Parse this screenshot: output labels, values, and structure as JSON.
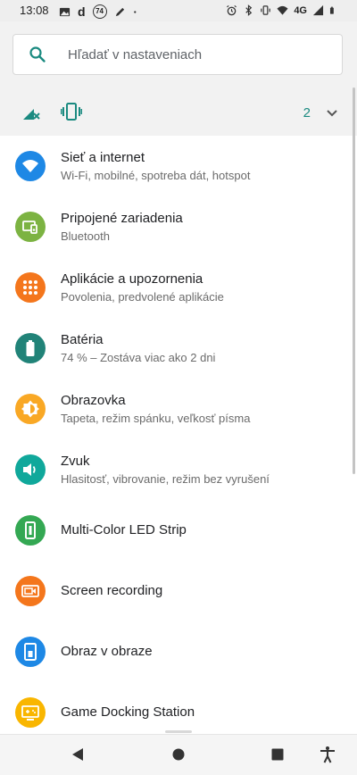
{
  "status_bar": {
    "time": "13:08",
    "badge": "74",
    "network": "4G",
    "left_icons": [
      "gallery-icon",
      "d-app-icon",
      "notification-74-icon",
      "pen-icon",
      "dot-icon"
    ],
    "right_icons": [
      "alarm-icon",
      "bluetooth-icon",
      "vibrate-icon",
      "wifi-icon",
      "signal-icon",
      "battery-icon"
    ]
  },
  "search": {
    "placeholder": "Hľadať v nastaveniach"
  },
  "conditions": {
    "count": "2",
    "icons": [
      "no-signal-icon",
      "vibrate-icon"
    ]
  },
  "settings": {
    "items": [
      {
        "title": "Sieť a internet",
        "subtitle": "Wi-Fi, mobilné, spotreba dát, hotspot",
        "icon": "wifi-icon",
        "color": "#1e88e5"
      },
      {
        "title": "Pripojené zariadenia",
        "subtitle": "Bluetooth",
        "icon": "devices-icon",
        "color": "#7cb342"
      },
      {
        "title": "Aplikácie a upozornenia",
        "subtitle": "Povolenia, predvolené aplikácie",
        "icon": "apps-grid-icon",
        "color": "#f4761c"
      },
      {
        "title": "Batéria",
        "subtitle": "74 % – Zostáva viac ako 2 dni",
        "icon": "battery-icon",
        "color": "#218378"
      },
      {
        "title": "Obrazovka",
        "subtitle": "Tapeta, režim spánku, veľkosť písma",
        "icon": "brightness-icon",
        "color": "#f9a825"
      },
      {
        "title": "Zvuk",
        "subtitle": "Hlasitosť, vibrovanie, režim bez vyrušení",
        "icon": "volume-icon",
        "color": "#10a89b"
      },
      {
        "title": "Multi-Color LED Strip",
        "subtitle": "",
        "icon": "led-strip-icon",
        "color": "#34a853"
      },
      {
        "title": "Screen recording",
        "subtitle": "",
        "icon": "video-camera-icon",
        "color": "#f4761c"
      },
      {
        "title": "Obraz v obraze",
        "subtitle": "",
        "icon": "picture-in-picture-icon",
        "color": "#1e88e5"
      },
      {
        "title": "Game Docking Station",
        "subtitle": "",
        "icon": "dock-station-icon",
        "color": "#f9b600"
      }
    ]
  },
  "nav_bar": {
    "buttons": [
      "back-icon",
      "home-icon",
      "recents-icon",
      "accessibility-icon"
    ]
  }
}
